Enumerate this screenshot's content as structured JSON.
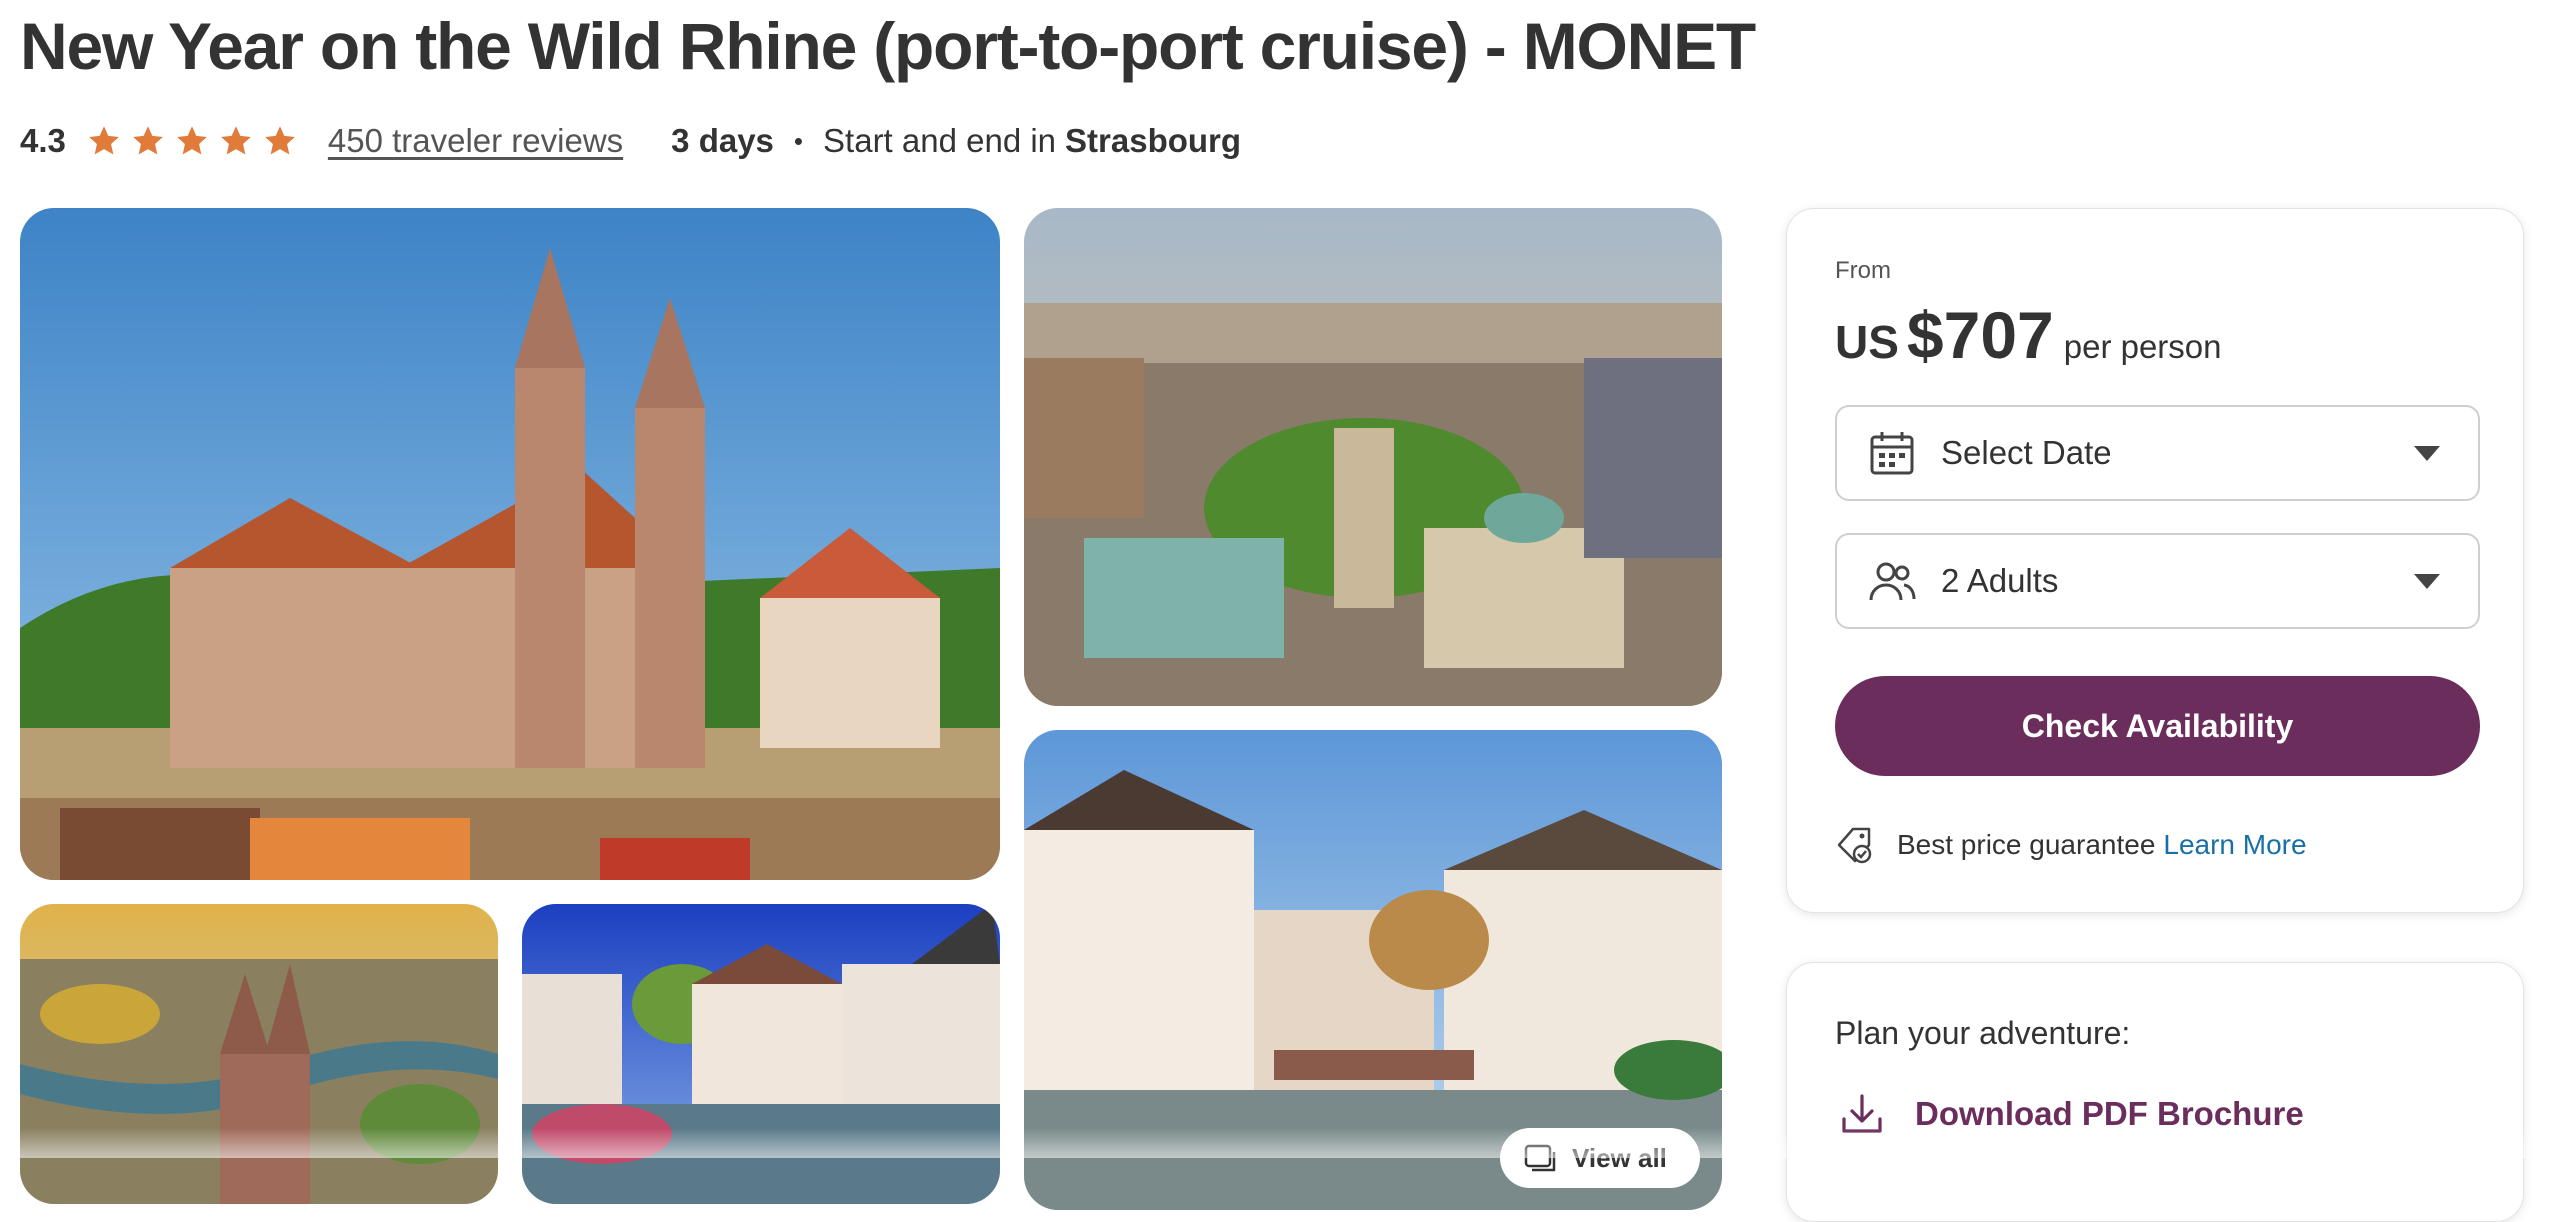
{
  "header": {
    "title": "New Year on the Wild Rhine (port-to-port cruise) - MONET",
    "rating_value": "4.3",
    "star_rating": 4.3,
    "reviews_link": "450 traveler reviews",
    "duration": "3 days",
    "dot": "•",
    "start_end_prefix": "Start and end in",
    "start_end_city": "Strasbourg"
  },
  "gallery": {
    "photos": [
      {
        "name": "photo-church-hilltop"
      },
      {
        "name": "photo-aerial-city-square"
      },
      {
        "name": "photo-aerial-church-river"
      },
      {
        "name": "photo-timbered-houses-water"
      },
      {
        "name": "photo-canal-timbered-houses"
      }
    ],
    "view_all_label": "View all"
  },
  "booking": {
    "from_label": "From",
    "currency": "US",
    "price": "$707",
    "per_person": "per person",
    "date_select": {
      "label": "Select Date",
      "icon": "calendar-icon"
    },
    "travelers_select": {
      "label": "2 Adults",
      "icon": "people-icon"
    },
    "cta_label": "Check Availability",
    "guarantee_text": "Best price guarantee",
    "learn_more": "Learn More"
  },
  "plan": {
    "title": "Plan your adventure:",
    "download_label": "Download PDF Brochure"
  },
  "colors": {
    "brand_purple": "#6b2d5c",
    "star_orange": "#e07b39",
    "link_blue": "#1b6fa8",
    "text": "#333333"
  }
}
